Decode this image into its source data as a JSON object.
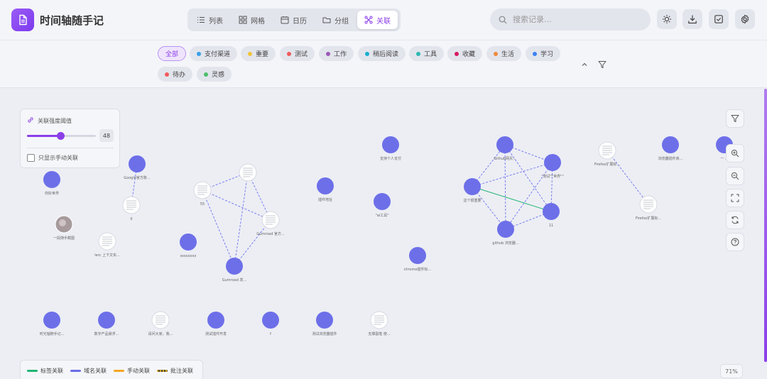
{
  "app": {
    "title": "时间轴随手记"
  },
  "view_tabs": [
    {
      "label": "列表",
      "icon": "list-icon",
      "active": false
    },
    {
      "label": "网格",
      "icon": "grid-icon",
      "active": false
    },
    {
      "label": "日历",
      "icon": "calendar-icon",
      "active": false
    },
    {
      "label": "分组",
      "icon": "folder-icon",
      "active": false
    },
    {
      "label": "关联",
      "icon": "graph-icon",
      "active": true
    }
  ],
  "search": {
    "placeholder": "搜索记录..."
  },
  "header_buttons": [
    "sun-icon",
    "download-icon",
    "checkbox-icon",
    "gear-icon"
  ],
  "tags": [
    {
      "label": "全部",
      "color": null,
      "active": true
    },
    {
      "label": "支付渠道",
      "color": "#3aa0e8"
    },
    {
      "label": "重要",
      "color": "#f2c53d"
    },
    {
      "label": "测试",
      "color": "#ef5b5b"
    },
    {
      "label": "工作",
      "color": "#9b59b6"
    },
    {
      "label": "稍后阅读",
      "color": "#1aaed0"
    },
    {
      "label": "工具",
      "color": "#2fb8b0"
    },
    {
      "label": "收藏",
      "color": "#d81b60"
    },
    {
      "label": "生活",
      "color": "#f08a3c"
    },
    {
      "label": "学习",
      "color": "#3b82f6"
    },
    {
      "label": "待办",
      "color": "#ef5b5b"
    },
    {
      "label": "灵感",
      "color": "#4cbf6a"
    }
  ],
  "threshold": {
    "title": "关联强度阈值",
    "value": 48,
    "fraction": 0.48,
    "checkbox_label": "只显示手动关联",
    "checked": false
  },
  "legend": [
    {
      "label": "标签关联",
      "color": "#22b573",
      "style": "solid"
    },
    {
      "label": "域名关联",
      "color": "#6b6ee8",
      "style": "solid"
    },
    {
      "label": "手动关联",
      "color": "#f5a623",
      "style": "solid"
    },
    {
      "label": "批注关联",
      "color": "#c9a227",
      "style": "dashed"
    }
  ],
  "zoom": "71%",
  "colors": {
    "accent": "#8b3fe8",
    "node": "#6d6fe9",
    "edge": "#7b7ef0",
    "tag_edge": "#22b573"
  },
  "graph": {
    "nodes": [
      {
        "id": "n1",
        "label": "你好世界",
        "kind": "circle"
      },
      {
        "id": "n2",
        "label": "Google官方账...",
        "kind": "circle"
      },
      {
        "id": "n3",
        "label": "0",
        "kind": "thumb"
      },
      {
        "id": "n4",
        "label": "一段随手截图",
        "kind": "photo"
      },
      {
        "id": "n5",
        "label": "lerc 上下文实...",
        "kind": "thumb"
      },
      {
        "id": "n6",
        "label": "55",
        "kind": "thumb"
      },
      {
        "id": "n7",
        "label": "",
        "kind": "thumb"
      },
      {
        "id": "n8",
        "label": "Gumroad 官方...",
        "kind": "thumb"
      },
      {
        "id": "n9",
        "label": "sssxxxxx",
        "kind": "circle"
      },
      {
        "id": "n10",
        "label": "Gumroad 发...",
        "kind": "circle"
      },
      {
        "id": "n11",
        "label": "插件地址",
        "kind": "circle"
      },
      {
        "id": "n12",
        "label": "支持个人支付",
        "kind": "circle"
      },
      {
        "id": "n13",
        "label": "\"ai工具\"",
        "kind": "circle"
      },
      {
        "id": "n14",
        "label": "chrome插件标...",
        "kind": "circle"
      },
      {
        "id": "n15",
        "label": "这个很重要",
        "kind": "circle"
      },
      {
        "id": "n16",
        "label": "Github网页...",
        "kind": "circle"
      },
      {
        "id": "n17",
        "label": "\"测试\"\"世界\"\"",
        "kind": "circle"
      },
      {
        "id": "n18",
        "label": "11",
        "kind": "circle"
      },
      {
        "id": "n19",
        "label": "github 浏览器...",
        "kind": "circle"
      },
      {
        "id": "n20",
        "label": "Firefox扩展标...",
        "kind": "thumb"
      },
      {
        "id": "n21",
        "label": "Firefox扩展标...",
        "kind": "thumb"
      },
      {
        "id": "n22",
        "label": "浏览器插件商...",
        "kind": "circle"
      },
      {
        "id": "n23",
        "label": "一 ...",
        "kind": "circle"
      },
      {
        "id": "n24",
        "label": "时光轴随手记...",
        "kind": "circle"
      },
      {
        "id": "n25",
        "label": "数字产品悬浮...",
        "kind": "circle"
      },
      {
        "id": "n26",
        "label": "请问大家，我...",
        "kind": "thumb"
      },
      {
        "id": "n27",
        "label": "测试插件开发",
        "kind": "circle"
      },
      {
        "id": "n28",
        "label": "f",
        "kind": "circle"
      },
      {
        "id": "n29",
        "label": "测试浏览器插件",
        "kind": "circle"
      },
      {
        "id": "n30",
        "label": "支撑副笔 使...",
        "kind": "thumb"
      }
    ],
    "edges": [
      [
        "n2",
        "n3",
        "domain"
      ],
      [
        "n6",
        "n7",
        "domain"
      ],
      [
        "n6",
        "n8",
        "domain"
      ],
      [
        "n6",
        "n10",
        "domain"
      ],
      [
        "n7",
        "n8",
        "domain"
      ],
      [
        "n7",
        "n10",
        "domain"
      ],
      [
        "n8",
        "n10",
        "domain"
      ],
      [
        "n15",
        "n16",
        "domain"
      ],
      [
        "n15",
        "n17",
        "domain"
      ],
      [
        "n15",
        "n19",
        "domain"
      ],
      [
        "n16",
        "n17",
        "domain"
      ],
      [
        "n16",
        "n18",
        "domain"
      ],
      [
        "n16",
        "n19",
        "domain"
      ],
      [
        "n17",
        "n18",
        "domain"
      ],
      [
        "n17",
        "n19",
        "domain"
      ],
      [
        "n18",
        "n19",
        "domain"
      ],
      [
        "n15",
        "n18",
        "tag"
      ],
      [
        "n20",
        "n21",
        "domain"
      ]
    ]
  }
}
